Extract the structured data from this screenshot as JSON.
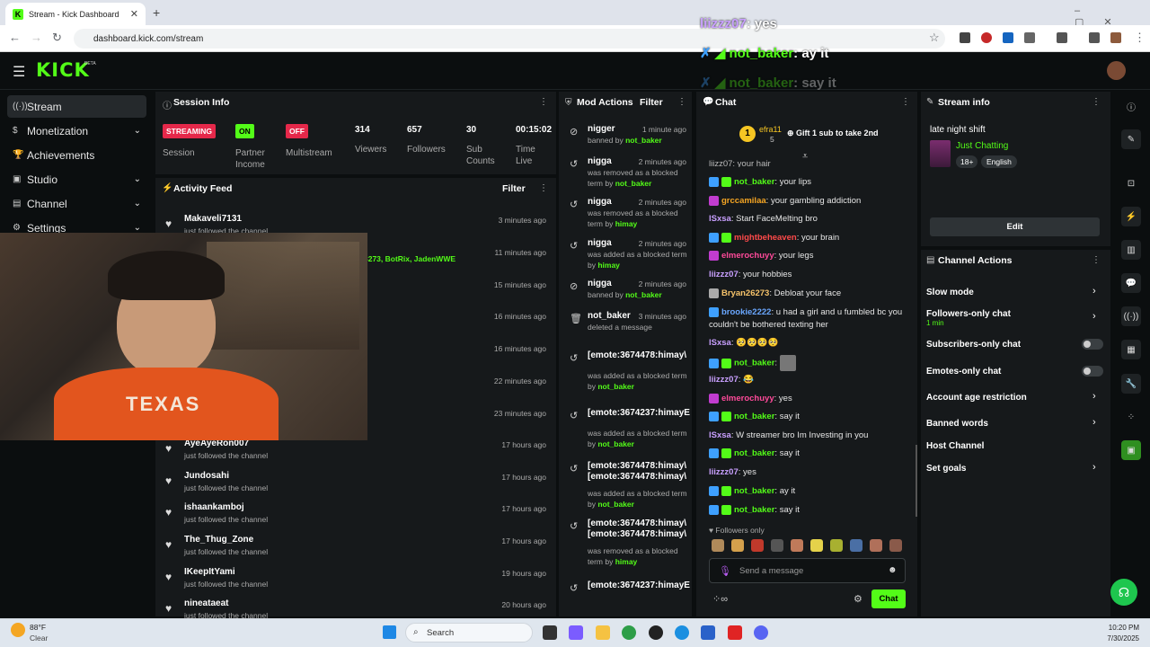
{
  "browser": {
    "tab_title": "Stream - Kick Dashboard",
    "url": "dashboard.kick.com/stream"
  },
  "header": {
    "logo": "KICK",
    "beta": "BETA"
  },
  "overlay_chat": [
    {
      "user": "liizzz07",
      "text": "yes"
    },
    {
      "user": "not_baker",
      "text": "ay it"
    },
    {
      "user": "not_baker",
      "text": "say it"
    }
  ],
  "sidebar": {
    "items": [
      {
        "label": "Stream",
        "icon": "stream-icon"
      },
      {
        "label": "Monetization",
        "icon": "dollar-icon"
      },
      {
        "label": "Achievements",
        "icon": "trophy-icon"
      },
      {
        "label": "Studio",
        "icon": "studio-icon"
      },
      {
        "label": "Channel",
        "icon": "channel-icon"
      },
      {
        "label": "Settings",
        "icon": "gear-icon"
      }
    ]
  },
  "session": {
    "title": "Session Info",
    "streaming": "STREAMING",
    "streaming_label": "Session",
    "on": "ON",
    "on_label": "Partner Income",
    "off": "OFF",
    "off_label": "Multistream",
    "viewers": "314",
    "viewers_label": "Viewers",
    "followers": "657",
    "followers_label": "Followers",
    "subs": "30",
    "subs_label": "Sub Counts",
    "time": "00:15:02",
    "time_label": "Time Live"
  },
  "activity": {
    "title": "Activity Feed",
    "filter": "Filter",
    "partial_names": "3273, BotRix, JadenWWE",
    "items": [
      {
        "name": "Makaveli7131",
        "sub": "just followed the channel",
        "time": "3 minutes ago"
      },
      {
        "name": "",
        "sub": "",
        "time": "11 minutes ago"
      },
      {
        "name": "",
        "sub": "",
        "time": "15 minutes ago"
      },
      {
        "name": "",
        "sub": "",
        "time": "16 minutes ago"
      },
      {
        "name": "",
        "sub": "",
        "time": "16 minutes ago"
      },
      {
        "name": "",
        "sub": "",
        "time": "22 minutes ago"
      },
      {
        "name": "",
        "sub": "",
        "time": "23 minutes ago"
      },
      {
        "name": "AyeAyeRon007",
        "sub": "just followed the channel",
        "time": "17 hours ago"
      },
      {
        "name": "Jundosahi",
        "sub": "just followed the channel",
        "time": "17 hours ago"
      },
      {
        "name": "ishaankamboj",
        "sub": "just followed the channel",
        "time": "17 hours ago"
      },
      {
        "name": "The_Thug_Zone",
        "sub": "just followed the channel",
        "time": "17 hours ago"
      },
      {
        "name": "IKeepItYami",
        "sub": "just followed the channel",
        "time": "19 hours ago"
      },
      {
        "name": "nineataeat",
        "sub": "just followed the channel",
        "time": "20 hours ago"
      }
    ]
  },
  "mod": {
    "title": "Mod Actions",
    "filter": "Filter",
    "items": [
      {
        "icon": "ban-icon",
        "title": "nigger",
        "time": "1 minute ago",
        "desc": "banned by ",
        "by": "not_baker"
      },
      {
        "icon": "undo-icon",
        "title": "nigga",
        "time": "2 minutes ago",
        "desc": "was removed as a blocked term by ",
        "by": "not_baker"
      },
      {
        "icon": "undo-icon",
        "title": "nigga",
        "time": "2 minutes ago",
        "desc": "was removed as a blocked term by ",
        "by": "himay"
      },
      {
        "icon": "undo-icon",
        "title": "nigga",
        "time": "2 minutes ago",
        "desc": "was added as a blocked term by ",
        "by": "himay"
      },
      {
        "icon": "ban-icon",
        "title": "nigga",
        "time": "2 minutes ago",
        "desc": "banned by ",
        "by": "not_baker"
      },
      {
        "icon": "trash-icon",
        "title": "not_baker",
        "time": "3 minutes ago",
        "desc": "deleted a message",
        "by": ""
      },
      {
        "icon": "undo-icon",
        "title": "[emote:3674478:himay\\",
        "time": "",
        "desc": "was added as a blocked term by ",
        "by": "not_baker"
      },
      {
        "icon": "undo-icon",
        "title": "[emote:3674237:himayE",
        "time": "",
        "desc": "was added as a blocked term by ",
        "by": "not_baker"
      },
      {
        "icon": "undo-icon",
        "title": "[emote:3674478:himay\\ [emote:3674478:himay\\",
        "time": "",
        "desc": "was added as a blocked term by ",
        "by": "not_baker"
      },
      {
        "icon": "undo-icon",
        "title": "[emote:3674478:himay\\ [emote:3674478:himay\\",
        "time": "",
        "desc": "was removed as a blocked term by ",
        "by": "himay"
      },
      {
        "icon": "undo-icon",
        "title": "[emote:3674237:himayE",
        "time": "",
        "desc": "",
        "by": ""
      }
    ]
  },
  "chat": {
    "title": "Chat",
    "pinned_user": "efra11",
    "pinned_count": "5",
    "gift": "Gift 1 sub to take 2nd",
    "partial_top": "liizz07: your hair",
    "messages": [
      {
        "user": "not_baker",
        "color": "#53fc18",
        "text": "your lips",
        "badges": [
          "#3ea0ff",
          "#53fc18"
        ]
      },
      {
        "user": "grccamilaa",
        "color": "#f6a623",
        "text": "your gambling addiction",
        "badges": [
          "#c13ccf"
        ]
      },
      {
        "user": "lSxsa",
        "color": "#c9a0ff",
        "text": "Start FaceMelting bro",
        "badges": []
      },
      {
        "user": "mightbeheaven",
        "color": "#ff4a4a",
        "text": "your brain",
        "badges": [
          "#3ea0ff",
          "#53fc18"
        ]
      },
      {
        "user": "elmerochuyy",
        "color": "#ff4a9a",
        "text": "your legs",
        "badges": [
          "#c13ccf"
        ]
      },
      {
        "user": "liizzz07",
        "color": "#c9a0ff",
        "text": "your hobbies",
        "badges": []
      },
      {
        "user": "Bryan26273",
        "color": "#f6c36a",
        "text": "Debloat your face",
        "badges": [
          "#aaa"
        ]
      },
      {
        "user": "brookie2222",
        "color": "#6aa7ff",
        "text": "u had a girl and u fumbled bc you couldn't be bothered texting her",
        "badges": [
          "#3ea0ff"
        ]
      },
      {
        "user": "lSxsa",
        "color": "#c9a0ff",
        "text": "🥺🥺🥺🥺",
        "badges": []
      },
      {
        "user": "not_baker",
        "color": "#53fc18",
        "text": "",
        "badges": [
          "#3ea0ff",
          "#53fc18"
        ]
      },
      {
        "user": "liizzz07",
        "color": "#c9a0ff",
        "text": "😂",
        "badges": []
      },
      {
        "user": "elmerochuyy",
        "color": "#ff4a9a",
        "text": "yes",
        "badges": [
          "#c13ccf"
        ]
      },
      {
        "user": "not_baker",
        "color": "#53fc18",
        "text": "say it",
        "badges": [
          "#3ea0ff",
          "#53fc18"
        ]
      },
      {
        "user": "lSxsa",
        "color": "#c9a0ff",
        "text": "W streamer bro Im Investing in you",
        "badges": []
      },
      {
        "user": "not_baker",
        "color": "#53fc18",
        "text": "say it",
        "badges": [
          "#3ea0ff",
          "#53fc18"
        ]
      },
      {
        "user": "liizzz07",
        "color": "#c9a0ff",
        "text": "yes",
        "badges": []
      },
      {
        "user": "not_baker",
        "color": "#53fc18",
        "text": "ay it",
        "badges": [
          "#3ea0ff",
          "#53fc18"
        ]
      },
      {
        "user": "not_baker",
        "color": "#53fc18",
        "text": "say it",
        "badges": [
          "#3ea0ff",
          "#53fc18"
        ]
      }
    ],
    "followers_only": "Followers only",
    "placeholder": "Send a message",
    "send": "Chat"
  },
  "stream_info": {
    "title": "Stream info",
    "stream_title": "late night shift",
    "category": "Just Chatting",
    "tags": [
      "18+",
      "English"
    ],
    "edit": "Edit"
  },
  "channel_actions": {
    "title": "Channel Actions",
    "items": [
      {
        "label": "Slow mode",
        "control": "chevron"
      },
      {
        "label": "Followers-only chat",
        "sub": "1 min",
        "control": "chevron"
      },
      {
        "label": "Subscribers-only chat",
        "control": "toggle"
      },
      {
        "label": "Emotes-only chat",
        "control": "toggle"
      },
      {
        "label": "Account age restriction",
        "control": "chevron"
      },
      {
        "label": "Banned words",
        "control": "chevron"
      },
      {
        "label": "Host Channel",
        "control": "none"
      },
      {
        "label": "Set goals",
        "control": "chevron"
      }
    ]
  },
  "taskbar": {
    "weather_temp": "88°F",
    "weather_text": "Clear",
    "search": "Search",
    "time": "10:20 PM",
    "date": "7/30/2025"
  }
}
